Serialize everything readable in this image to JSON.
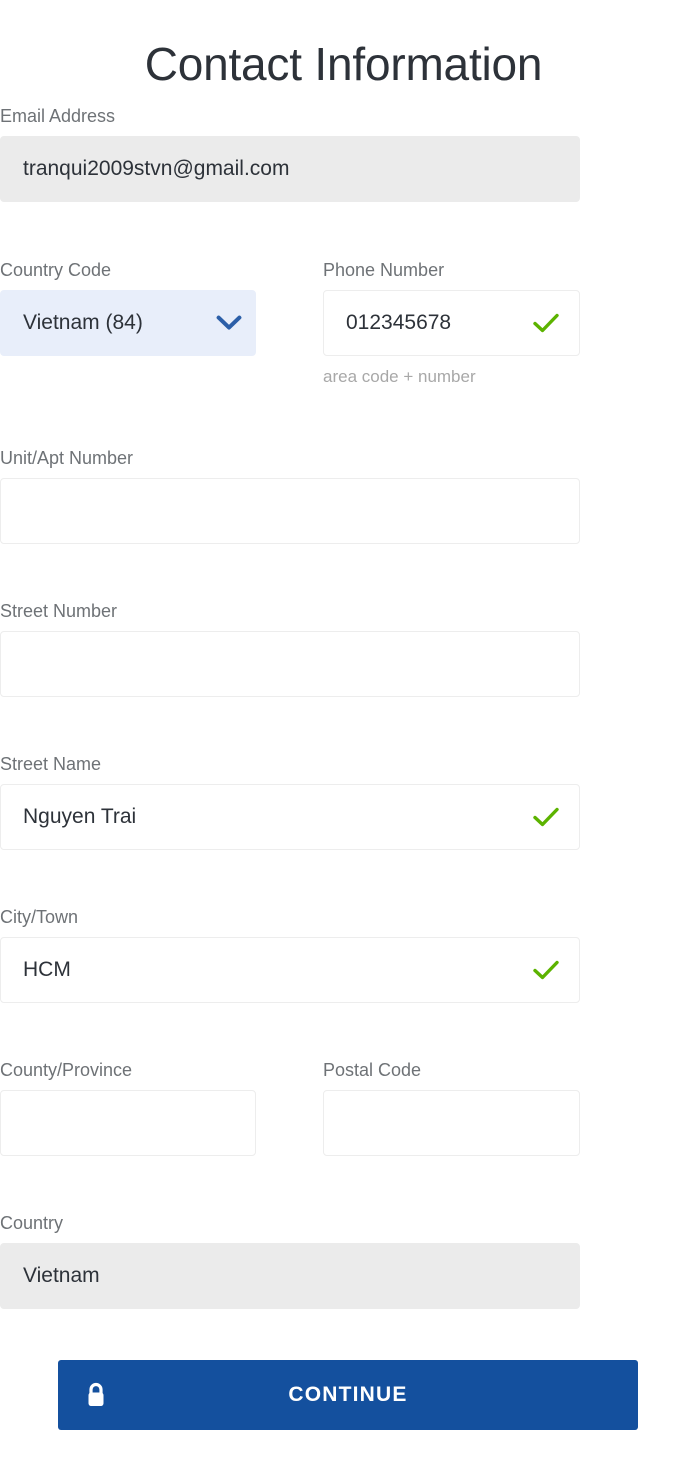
{
  "page": {
    "title": "Contact Information"
  },
  "colors": {
    "title_text": "#2d3239",
    "label_text": "#6e7276",
    "value_text": "#2d3239",
    "helper_text": "#a8a8a8",
    "field_border": "#ededed",
    "disabled_bg": "#ebebeb",
    "select_bg": "#e8eefa",
    "chevron_blue": "#2c5fa8",
    "valid_green": "#5cb300",
    "button_blue": "#14509e",
    "button_text": "#ffffff"
  },
  "fields": {
    "email": {
      "label": "Email Address",
      "value": "tranqui2009stvn@gmail.com",
      "placeholder": "",
      "disabled": true,
      "valid_icon": "",
      "state": "read-only"
    },
    "country_code": {
      "label": "Country Code",
      "value": "Vietnam (84)",
      "placeholder": "",
      "icon": "chevron-down-icon",
      "state": "select-open-available"
    },
    "phone_number": {
      "label": "Phone Number",
      "value": "012345678",
      "placeholder": "",
      "helper": "area code + number",
      "icon": "check-icon",
      "state": "valid"
    },
    "unit_apt": {
      "label": "Unit/Apt Number",
      "value": "",
      "placeholder": "",
      "state": "empty"
    },
    "street_number": {
      "label": "Street Number",
      "value": "",
      "placeholder": "",
      "state": "empty"
    },
    "street_name": {
      "label": "Street Name",
      "value": "Nguyen Trai",
      "placeholder": "",
      "icon": "check-icon",
      "state": "valid"
    },
    "city_town": {
      "label": "City/Town",
      "value": "HCM",
      "placeholder": "",
      "icon": "check-icon",
      "state": "valid"
    },
    "county_province": {
      "label": "County/Province",
      "value": "",
      "placeholder": "",
      "state": "empty"
    },
    "postal_code": {
      "label": "Postal Code",
      "value": "",
      "placeholder": "",
      "state": "empty"
    },
    "country": {
      "label": "Country",
      "value": "Vietnam",
      "placeholder": "",
      "disabled": true,
      "state": "read-only"
    }
  },
  "actions": {
    "continue": {
      "label": "CONTINUE",
      "icon": "lock-icon"
    }
  }
}
